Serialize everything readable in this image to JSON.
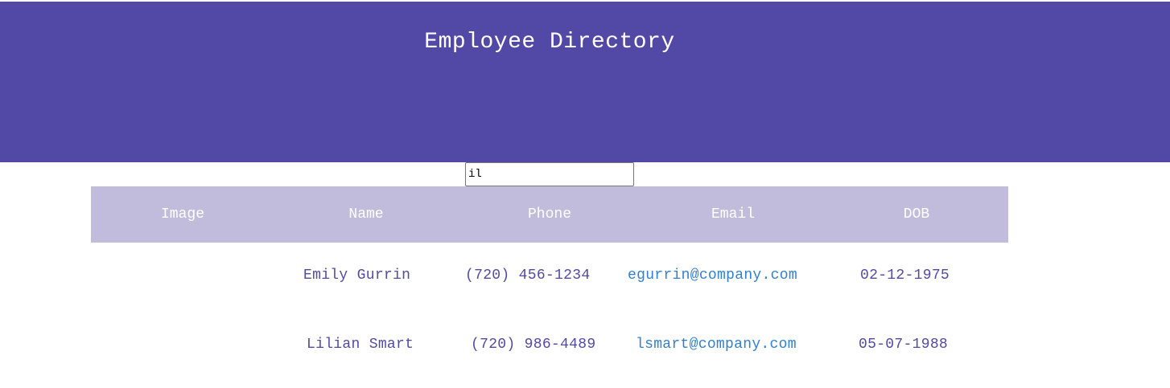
{
  "header": {
    "title": "Employee Directory"
  },
  "search": {
    "value": "il"
  },
  "table": {
    "columns": [
      "Image",
      "Name",
      "Phone",
      "Email",
      "DOB"
    ],
    "rows": [
      {
        "name": "Emily Gurrin",
        "phone": "(720) 456-1234",
        "email": "egurrin@company.com",
        "dob": "02-12-1975"
      },
      {
        "name": "Lilian Smart",
        "phone": "(720) 986-4489",
        "email": "lsmart@company.com",
        "dob": "05-07-1988"
      }
    ]
  },
  "colors": {
    "header_bg": "#5249a7",
    "table_header_bg": "#c2bcdc",
    "text": "#5249a7",
    "email": "#2f80d0"
  }
}
